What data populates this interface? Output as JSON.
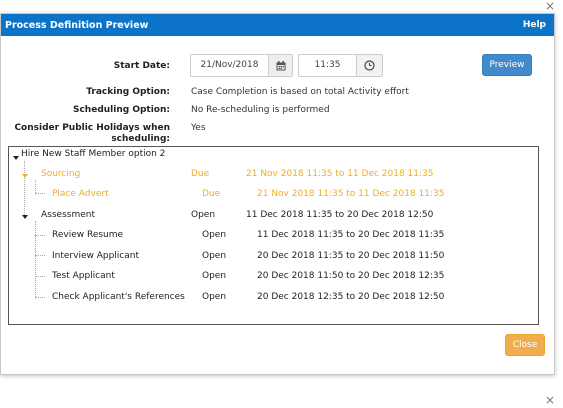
{
  "dialog": {
    "title": "Process Definition Preview",
    "help": "Help",
    "close_icon": "×"
  },
  "form": {
    "start_date_label": "Start Date:",
    "date_value": "21/Nov/2018",
    "time_value": "11:35",
    "tracking_label": "Tracking Option:",
    "tracking_value": "Case Completion is based on total Activity effort",
    "scheduling_label": "Scheduling Option:",
    "scheduling_value": "No Re-scheduling is performed",
    "holidays_label_line1": "Consider Public Holidays when",
    "holidays_label_line2": "scheduling:",
    "holidays_value": "Yes",
    "preview_label": "Preview"
  },
  "tree": {
    "root": "Hire New Staff Member option 2",
    "nodes": [
      {
        "name": "Sourcing",
        "status": "Due",
        "range": "21 Nov 2018 11:35 to 11 Dec 2018 11:35",
        "color": "#f0ad26"
      },
      {
        "name": "Place Advert",
        "status": "Due",
        "range": "21 Nov 2018 11:35 to 11 Dec 2018 11:35",
        "color": "#f0ad26"
      },
      {
        "name": "Assessment",
        "status": "Open",
        "range": "11 Dec 2018 11:35 to 20 Dec 2018 12:50",
        "color": "#222222"
      },
      {
        "name": "Review Resume",
        "status": "Open",
        "range": "11 Dec 2018 11:35 to 20 Dec 2018 11:35",
        "color": "#222222"
      },
      {
        "name": "Interview Applicant",
        "status": "Open",
        "range": "20 Dec 2018 11:35 to 20 Dec 2018 11:50",
        "color": "#222222"
      },
      {
        "name": "Test Applicant",
        "status": "Open",
        "range": "20 Dec 2018 11:50 to 20 Dec 2018 12:35",
        "color": "#222222"
      },
      {
        "name": "Check Applicant's References",
        "status": "Open",
        "range": "20 Dec 2018 12:35 to 20 Dec 2018 12:50",
        "color": "#222222"
      }
    ]
  },
  "footer": {
    "close_label": "Close"
  },
  "colors": {
    "titlebar": "#0b73c8",
    "primary": "#428bca",
    "warning": "#f0ad4e",
    "due": "#f0ad26"
  }
}
